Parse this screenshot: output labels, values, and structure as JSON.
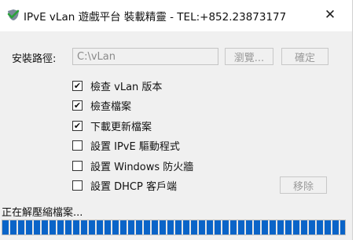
{
  "window": {
    "title": "IPvE vLan 遊戲平台 裝載精靈 - TEL:+852.23873177",
    "close_glyph": "✕"
  },
  "install_path": {
    "label": "安裝路徑:",
    "value": "C:\\vLan",
    "browse_label": "瀏覽...",
    "confirm_label": "確定"
  },
  "options": [
    {
      "label": "檢查 vLan 版本",
      "checked": true
    },
    {
      "label": "檢查檔案",
      "checked": true
    },
    {
      "label": "下載更新檔案",
      "checked": true
    },
    {
      "label": "設置 IPvE 驅動程式",
      "checked": false
    },
    {
      "label": "設置 Windows 防火牆",
      "checked": false
    },
    {
      "label": "設置 DHCP 客戶端",
      "checked": false
    }
  ],
  "remove_label": "移除",
  "status_text": "正在解壓縮檔案...",
  "progress": {
    "percent": 100,
    "color": "#0a64c8"
  },
  "icons": {
    "app": "shield-check-icon",
    "close": "close-icon"
  }
}
